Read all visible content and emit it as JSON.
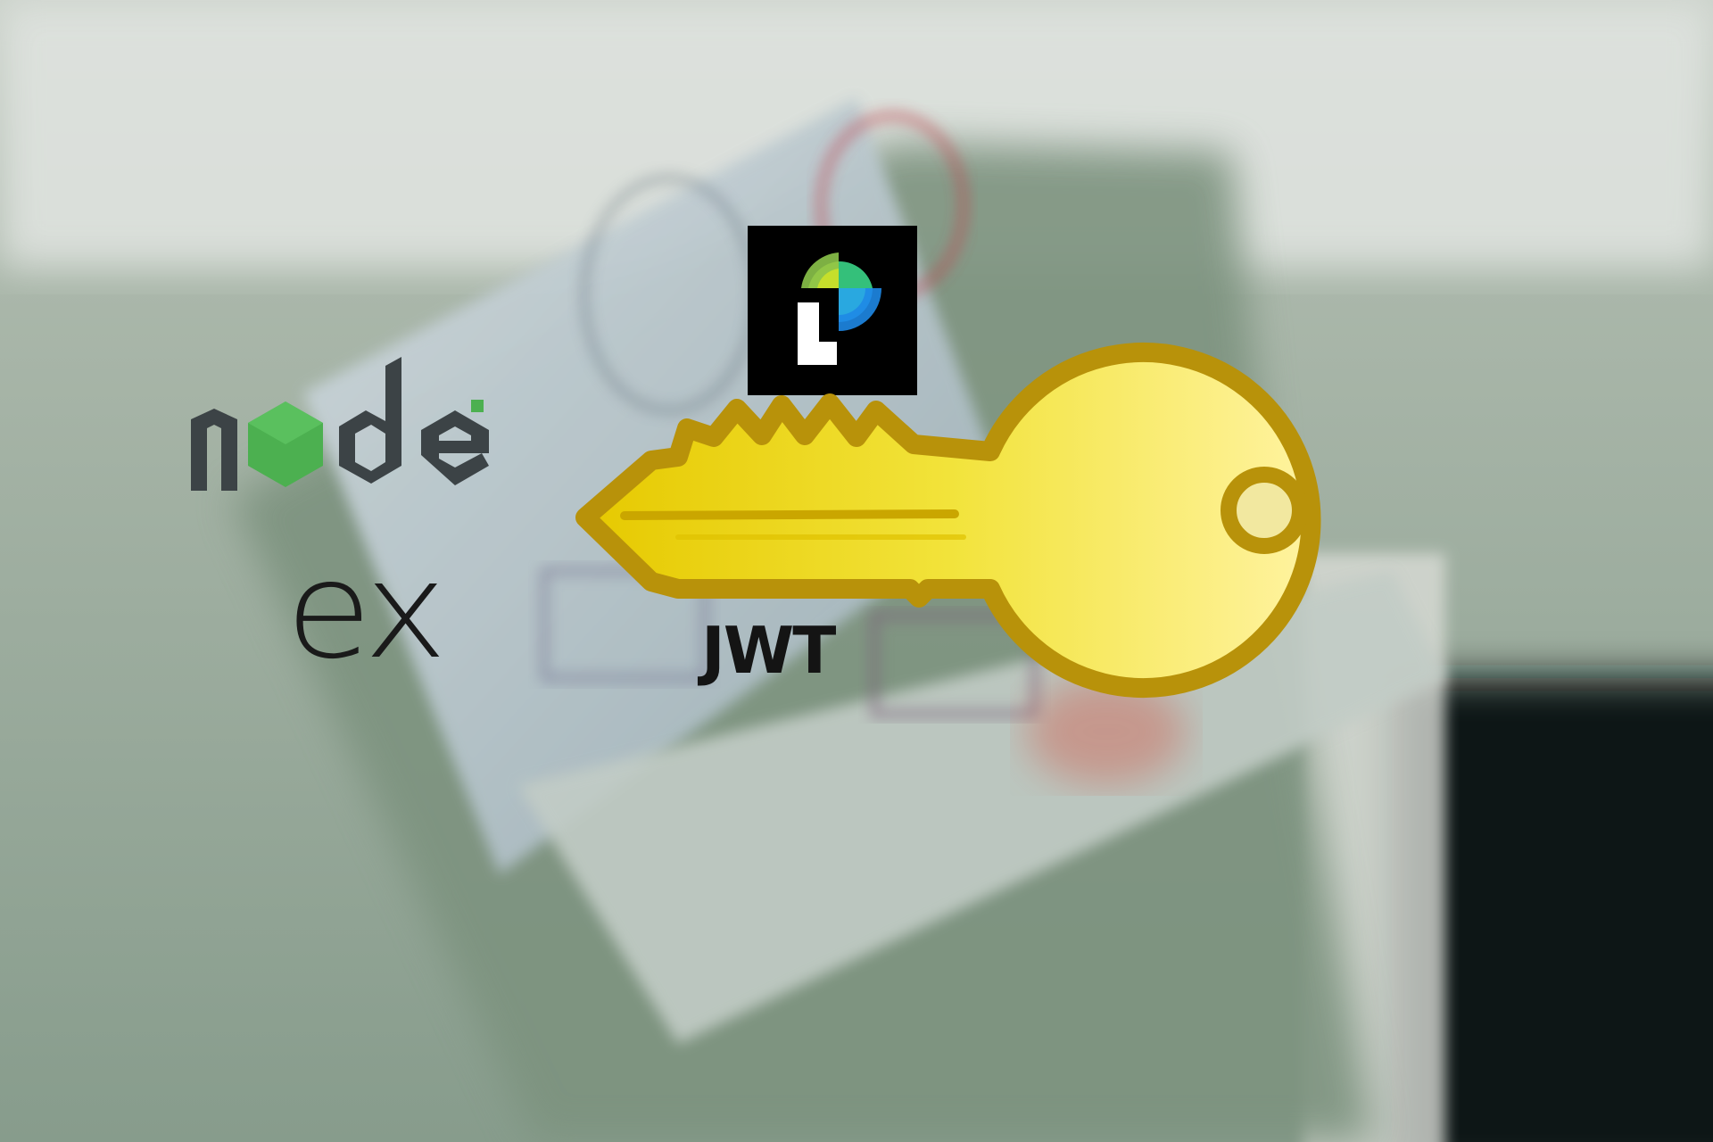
{
  "scene": {
    "description_tags": [
      "passport-photo",
      "node-logo",
      "express-logo",
      "passport-js-logo",
      "jwt-label",
      "key-icon"
    ]
  },
  "logos": {
    "node": {
      "text": "node",
      "accent_color": "#4cb050",
      "text_color": "#3c4346"
    },
    "express": {
      "text": "ex",
      "color": "#1a1a1a"
    },
    "passport": {
      "bg_color": "#000000"
    },
    "jwt": {
      "text": "JWT"
    }
  },
  "colors": {
    "key_gold": "#f2e33a",
    "key_outline": "#b8920a",
    "background_green": "#8fa293"
  }
}
